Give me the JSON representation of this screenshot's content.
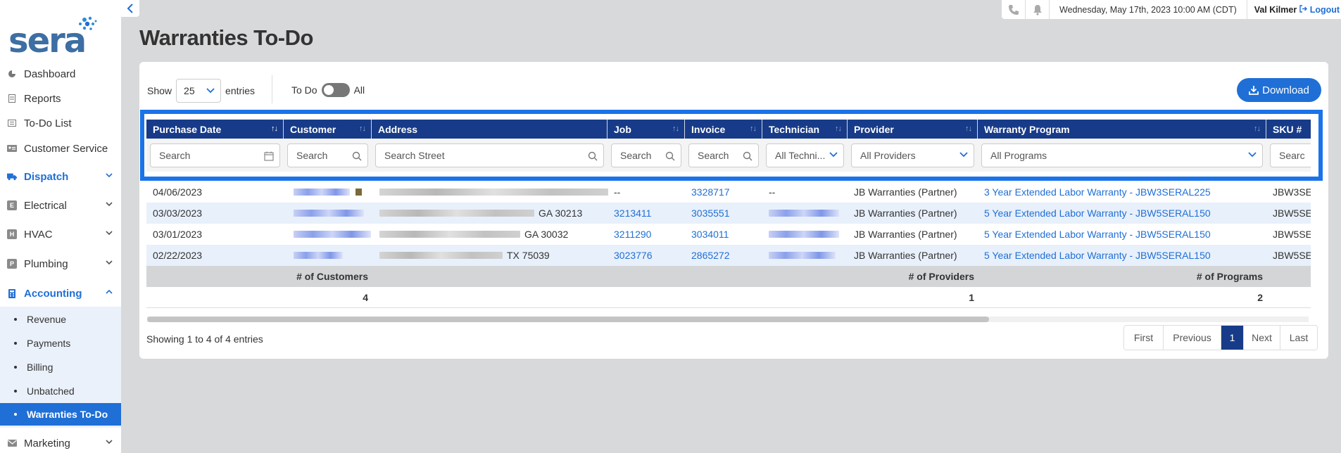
{
  "sidebar": {
    "logo_text": "sera",
    "items": [
      {
        "label": "Dashboard",
        "icon": "pie-chart-icon"
      },
      {
        "label": "Reports",
        "icon": "document-icon"
      },
      {
        "label": "To-Do List",
        "icon": "list-icon"
      },
      {
        "label": "Customer Service",
        "icon": "id-card-icon"
      },
      {
        "label": "Dispatch",
        "icon": "truck-icon"
      },
      {
        "label": "Electrical",
        "icon": "E"
      },
      {
        "label": "HVAC",
        "icon": "H"
      },
      {
        "label": "Plumbing",
        "icon": "P"
      },
      {
        "label": "Accounting",
        "icon": "calculator-icon"
      },
      {
        "label": "Marketing",
        "icon": "mail-icon"
      }
    ],
    "accounting_sub": [
      "Revenue",
      "Payments",
      "Billing",
      "Unbatched",
      "Warranties To-Do"
    ]
  },
  "topbar": {
    "datetime": "Wednesday, May 17th, 2023 10:00 AM (CDT)",
    "user": "Val Kilmer",
    "logout": "Logout"
  },
  "page": {
    "title": "Warranties To-Do"
  },
  "controls": {
    "show_label": "Show",
    "entries_value": "25",
    "entries_label": "entries",
    "toggle_left": "To Do",
    "toggle_right": "All",
    "download": "Download"
  },
  "table": {
    "headers": [
      "Purchase Date",
      "Customer",
      "Address",
      "Job",
      "Invoice",
      "Technician",
      "Provider",
      "Warranty Program",
      "SKU #"
    ],
    "filters": [
      "Search",
      "Search",
      "Search Street",
      "Search",
      "Search",
      "All Techni...",
      "All Providers",
      "All Programs",
      "Searc"
    ],
    "rows": [
      {
        "date": "04/06/2023",
        "address_tail": "",
        "job": "--",
        "invoice": "3328717",
        "tech": "--",
        "provider": "JB Warranties (Partner)",
        "program": "3 Year Extended Labor Warranty - JBW3SERAL225",
        "sku": "JBW3SE"
      },
      {
        "date": "03/03/2023",
        "address_tail": "GA 30213",
        "job": "3213411",
        "invoice": "3035551",
        "tech": "",
        "provider": "JB Warranties (Partner)",
        "program": "5 Year Extended Labor Warranty - JBW5SERAL150",
        "sku": "JBW5SE"
      },
      {
        "date": "03/01/2023",
        "address_tail": "GA 30032",
        "job": "3211290",
        "invoice": "3034011",
        "tech": "",
        "provider": "JB Warranties (Partner)",
        "program": "5 Year Extended Labor Warranty - JBW5SERAL150",
        "sku": "JBW5SE"
      },
      {
        "date": "02/22/2023",
        "address_tail": "TX 75039",
        "job": "3023776",
        "invoice": "2865272",
        "tech": "",
        "provider": "JB Warranties (Partner)",
        "program": "5 Year Extended Labor Warranty - JBW5SERAL150",
        "sku": "JBW5SE"
      }
    ],
    "summary_labels": {
      "customers": "# of Customers",
      "providers": "# of Providers",
      "programs": "# of Programs"
    },
    "summary_values": {
      "customers": "4",
      "providers": "1",
      "programs": "2"
    }
  },
  "footer": {
    "showing": "Showing 1 to 4 of 4 entries",
    "pager": [
      "First",
      "Previous",
      "1",
      "Next",
      "Last"
    ]
  }
}
